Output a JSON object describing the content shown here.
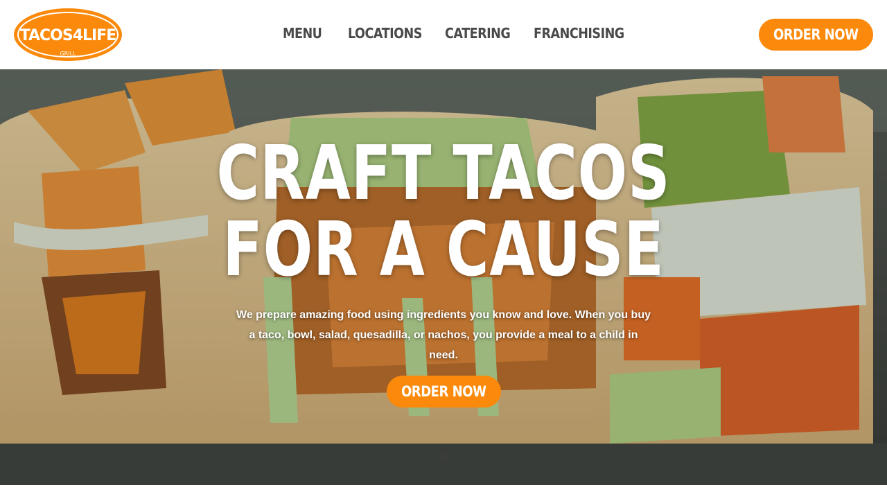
{
  "brand": {
    "logo_text_main": "TACOS4LIFE",
    "logo_text_sub": "GRILL",
    "accent": "#fb8a0c"
  },
  "nav": {
    "items": [
      {
        "label": "MENU"
      },
      {
        "label": "LOCATIONS"
      },
      {
        "label": "CATERING"
      },
      {
        "label": "FRANCHISING"
      }
    ],
    "order_label": "ORDER NOW"
  },
  "hero": {
    "headline_line1": "CRAFT TACOS",
    "headline_line2": "FOR A CAUSE",
    "subtext": "We prepare amazing food using ingredients you know and love. When you buy a taco, bowl, salad, quesadilla, or nachos, you provide a meal to a child in need.",
    "cta_label": "ORDER NOW",
    "slide_indicator_count": 1
  }
}
